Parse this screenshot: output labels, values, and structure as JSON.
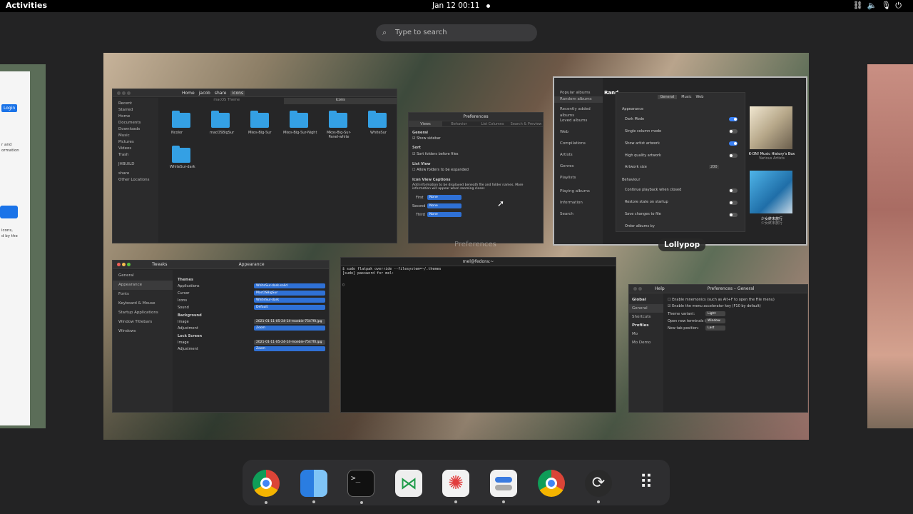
{
  "topbar": {
    "activities": "Activities",
    "clock": "Jan 12  00:11",
    "tray_icons": [
      "network-icon",
      "volume-icon",
      "mic-icon",
      "power-icon"
    ]
  },
  "search": {
    "placeholder": "Type to search"
  },
  "windows": {
    "files": {
      "path": [
        "Home",
        "jacob",
        "share",
        "icons"
      ],
      "tabs": [
        "macOS Theme",
        "icons"
      ],
      "sidebar": [
        "Recent",
        "Starred",
        "Home",
        "Documents",
        "Downloads",
        "Music",
        "Pictures",
        "Videos",
        "Trash",
        "JHBUILD",
        "share",
        "Other Locations"
      ],
      "folders": [
        "Ncolor",
        "macOSBigSur",
        "Mkos-Big-Sur",
        "Mkos-Big-Sur-Night",
        "Mkos-Big-Sur-Panel-white",
        "WhiteSur",
        "WhiteSur-dark"
      ]
    },
    "preferences": {
      "title": "Preferences",
      "tabs": [
        "Views",
        "Behavior",
        "List Columns",
        "Search & Preview"
      ],
      "general_label": "General",
      "show_sidebar": "Show sidebar",
      "sort_label": "Sort",
      "sort_folders": "Sort folders before files",
      "listview_label": "List View",
      "expand_folders": "Allow folders to be expanded",
      "captions_label": "Icon View Captions",
      "captions_desc": "Add information to be displayed beneath file and folder names. More information will appear when zooming closer.",
      "rows": [
        {
          "label": "First",
          "value": "None"
        },
        {
          "label": "Second",
          "value": "None"
        },
        {
          "label": "Third",
          "value": "None"
        }
      ],
      "hover_label": "Preferences"
    },
    "lollypop": {
      "label": "Lollypop",
      "title": "Rand",
      "sidebar": [
        "Popular albums",
        "Random albums",
        "Recently added albums",
        "Loved albums",
        "Web",
        "Compilations",
        "Artists",
        "Genres",
        "Playlists",
        "Playing albums",
        "Information",
        "Search"
      ],
      "settings_tabs": [
        "General",
        "Music",
        "Web"
      ],
      "appearance": "Appearance",
      "settings": [
        {
          "label": "Dark Mode",
          "on": true
        },
        {
          "label": "Single column mode",
          "on": false
        },
        {
          "label": "Show artist artwork",
          "on": true
        },
        {
          "label": "High quality artwork",
          "on": false
        }
      ],
      "artwork_size_label": "Artwork size",
      "artwork_size": "200",
      "behaviour": "Behaviour",
      "behaviour_settings": [
        {
          "label": "Continue playback when closed",
          "on": false
        },
        {
          "label": "Restore state on startup",
          "on": false
        },
        {
          "label": "Save changes to file",
          "on": false
        }
      ],
      "order_label": "Order albums by",
      "albums": [
        {
          "title": "K-ON! Music History's Box",
          "artist": "Various Artists"
        },
        {
          "title": "少女終末旅行",
          "artist": "少女終末旅行"
        }
      ]
    },
    "tweaks": {
      "app": "Tweaks",
      "title": "Appearance",
      "sidebar": [
        "General",
        "Appearance",
        "Fonts",
        "Keyboard & Mouse",
        "Startup Applications",
        "Window Titlebars",
        "Windows"
      ],
      "themes_label": "Themes",
      "themes": [
        {
          "label": "Applications",
          "value": "WhiteSur-dark-solid"
        },
        {
          "label": "Cursor",
          "value": "MacOSBigSur"
        },
        {
          "label": "Icons",
          "value": "WhiteSur-dark"
        },
        {
          "label": "Sound",
          "value": "Default"
        }
      ],
      "background_label": "Background",
      "background": [
        {
          "label": "Image",
          "value": "2021-01-11-05-24-14-moebie-7547f0.jpg"
        },
        {
          "label": "Adjustment",
          "value": "Zoom"
        }
      ],
      "lockscreen_label": "Lock Screen",
      "lockscreen": [
        {
          "label": "Image",
          "value": "2021-01-11-05-24-14-moebie-7547f0.jpg"
        },
        {
          "label": "Adjustment",
          "value": "Zoom"
        }
      ]
    },
    "terminal": {
      "title": "mel@fedora:~",
      "line1": "$ sudo flatpak override --filesystem=~/.themes",
      "line2": "[sudo] password for mel:"
    },
    "terminal_prefs": {
      "title": "Preferences – General",
      "sidebar_global": "Global",
      "sidebar": [
        "General",
        "Shortcuts"
      ],
      "profiles_label": "Profiles",
      "profiles": [
        "Mo",
        "Mo Demo"
      ],
      "options": [
        "Enable mnemonics (such as Alt+F to open the File menu)",
        "Enable the menu accelerator key (F10 by default)"
      ],
      "rows": [
        {
          "label": "Theme variant:",
          "value": "Light"
        },
        {
          "label": "Open new terminals in:",
          "value": "Window"
        },
        {
          "label": "New tab position:",
          "value": "Last"
        }
      ],
      "help": "Help"
    },
    "left_partial": {
      "login": "Login",
      "text": [
        "r and",
        "ormation",
        "icons,",
        "d by the"
      ]
    }
  },
  "dock": {
    "apps": [
      {
        "name": "chrome-icon",
        "running": true
      },
      {
        "name": "finder-icon",
        "running": true
      },
      {
        "name": "terminal-icon",
        "running": true
      },
      {
        "name": "vscode-icon",
        "running": false
      },
      {
        "name": "lollypop-icon",
        "running": true
      },
      {
        "name": "tweaks-icon",
        "running": true
      },
      {
        "name": "chrome-alt-icon",
        "running": false
      },
      {
        "name": "obs-icon",
        "running": true
      },
      {
        "name": "app-grid-icon",
        "running": false
      }
    ]
  },
  "colors": {
    "accent": "#2f71d6",
    "folder": "#34a0e4",
    "panel": "#000000",
    "dock": "#2e2e30"
  }
}
